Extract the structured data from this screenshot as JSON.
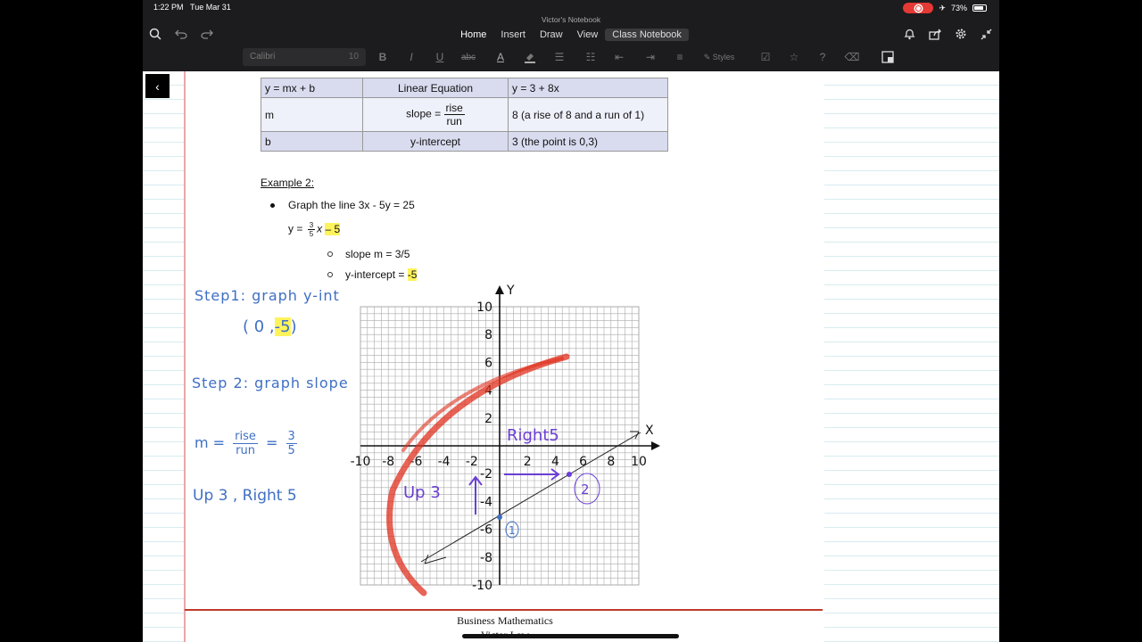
{
  "status_bar": {
    "time": "1:22 PM",
    "date": "Tue Mar 31",
    "notebook_name": "Victor's Notebook",
    "battery": "73%"
  },
  "tabs": [
    {
      "label": "Home"
    },
    {
      "label": "Insert"
    },
    {
      "label": "Draw"
    },
    {
      "label": "View"
    },
    {
      "label": "Class Notebook"
    }
  ],
  "ribbon": {
    "font_name": "Calibri",
    "font_size": "10",
    "icons": [
      "bold-icon",
      "italic-icon",
      "underline-icon",
      "strikethrough-icon",
      "font-color-icon",
      "highlight-icon",
      "bullet-list-icon",
      "numbered-list-icon",
      "outdent-icon",
      "indent-icon",
      "align-icon",
      "styles-icon",
      "todo-tag-icon",
      "important-tag-icon",
      "question-tag-icon",
      "clear-formatting-icon"
    ],
    "styles_label": "Styles"
  },
  "table": {
    "rows": [
      {
        "c1": "y = mx + b",
        "c2": "Linear Equation",
        "c3": "y = 3 + 8x"
      },
      {
        "c1": "m",
        "c2_prefix": "slope =",
        "c2_num": "rise",
        "c2_den": "run",
        "c3": "8 (a rise of 8 and a run of 1)"
      },
      {
        "c1": "b",
        "c2": "y-intercept",
        "c3": "3 (the point is 0,3)"
      }
    ]
  },
  "example": {
    "heading": "Example 2:",
    "bullet": "Graph the line 3x - 5y = 25",
    "eq_lhs": "y =",
    "eq_num": "3",
    "eq_den": "5",
    "eq_var": "x",
    "eq_tail": "– 5",
    "sub1": "slope m = 3/5",
    "sub2_prefix": "y-intercept =",
    "sub2_value": "-5"
  },
  "handwriting": {
    "step1": "Step1: graph   y-int",
    "step1_point_a": "( 0 ,",
    "step1_point_b": "-5",
    "step1_point_c": ")",
    "step2": "Step 2: graph  slope",
    "m_eq": "m =",
    "m_num": "rise",
    "m_den": "run",
    "m_eq2": "=",
    "m_num2": "3",
    "m_den2": "5",
    "up_right": "Up 3  , Right 5",
    "graph_up": "Up 3",
    "graph_right": "Right5",
    "mark1": "1",
    "mark2": "2"
  },
  "graph": {
    "x_label": "X",
    "y_label": "Y",
    "x_ticks": [
      "-10",
      "-8",
      "-6",
      "-4",
      "-2",
      "2",
      "4",
      "6",
      "8",
      "10"
    ],
    "y_ticks": [
      "10",
      "8",
      "6",
      "4",
      "2",
      "-2",
      "-4",
      "-6",
      "-8",
      "-10"
    ]
  },
  "footer": {
    "line1": "Business Mathematics",
    "line2": "Victor Law"
  },
  "colors": {
    "table_header": "#d9dbef",
    "highlight": "#fff35c",
    "ink_blue": "#3f6fc4",
    "ink_purple": "#6b3fd6",
    "ink_red": "#e0301e"
  }
}
